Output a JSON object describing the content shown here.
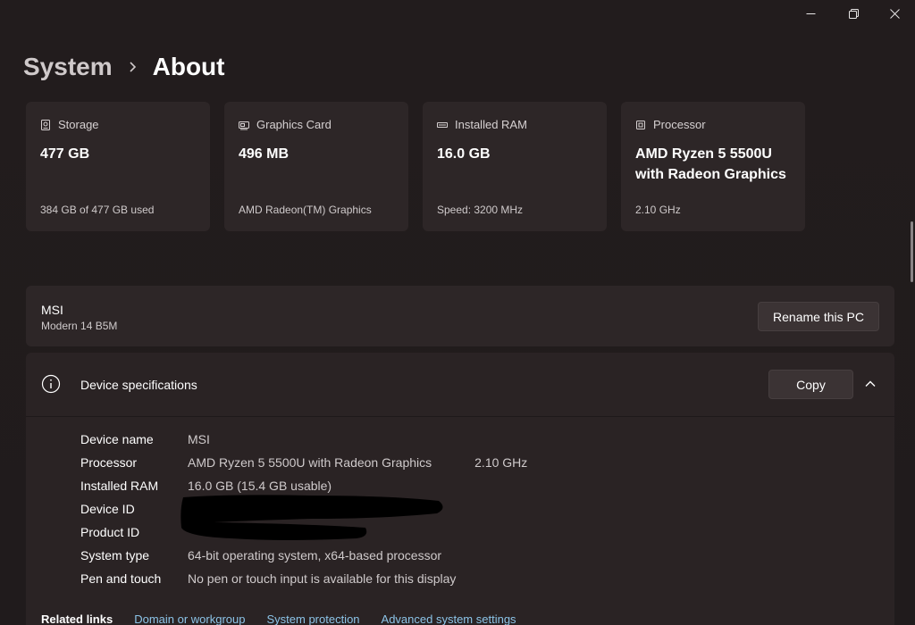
{
  "breadcrumb": {
    "parent": "System",
    "current": "About"
  },
  "cards": [
    {
      "icon": "storage-icon",
      "label": "Storage",
      "value": "477 GB",
      "sub": "384 GB of 477 GB used"
    },
    {
      "icon": "graphics-card-icon",
      "label": "Graphics Card",
      "value": "496 MB",
      "sub": "AMD Radeon(TM) Graphics"
    },
    {
      "icon": "ram-icon",
      "label": "Installed RAM",
      "value": "16.0 GB",
      "sub": "Speed: 3200 MHz"
    },
    {
      "icon": "processor-icon",
      "label": "Processor",
      "value": "AMD Ryzen 5 5500U with Radeon Graphics",
      "sub": "2.10 GHz"
    }
  ],
  "device": {
    "name": "MSI",
    "model": "Modern 14 B5M",
    "rename_label": "Rename this PC"
  },
  "specs": {
    "title": "Device specifications",
    "copy_label": "Copy",
    "rows": [
      {
        "label": "Device name",
        "value": "MSI",
        "extra": ""
      },
      {
        "label": "Processor",
        "value": "AMD Ryzen 5 5500U with Radeon Graphics",
        "extra": "2.10 GHz"
      },
      {
        "label": "Installed RAM",
        "value": "16.0 GB (15.4 GB usable)",
        "extra": ""
      },
      {
        "label": "Device ID",
        "value": "",
        "extra": ""
      },
      {
        "label": "Product ID",
        "value": "",
        "extra": ""
      },
      {
        "label": "System type",
        "value": "64-bit operating system, x64-based processor",
        "extra": ""
      },
      {
        "label": "Pen and touch",
        "value": "No pen or touch input is available for this display",
        "extra": ""
      }
    ]
  },
  "related": {
    "title": "Related links",
    "links": [
      "Domain or workgroup",
      "System protection",
      "Advanced system settings"
    ]
  },
  "colors": {
    "background": "#201b1c",
    "card": "#2d2627",
    "link": "#8cc4e8"
  }
}
